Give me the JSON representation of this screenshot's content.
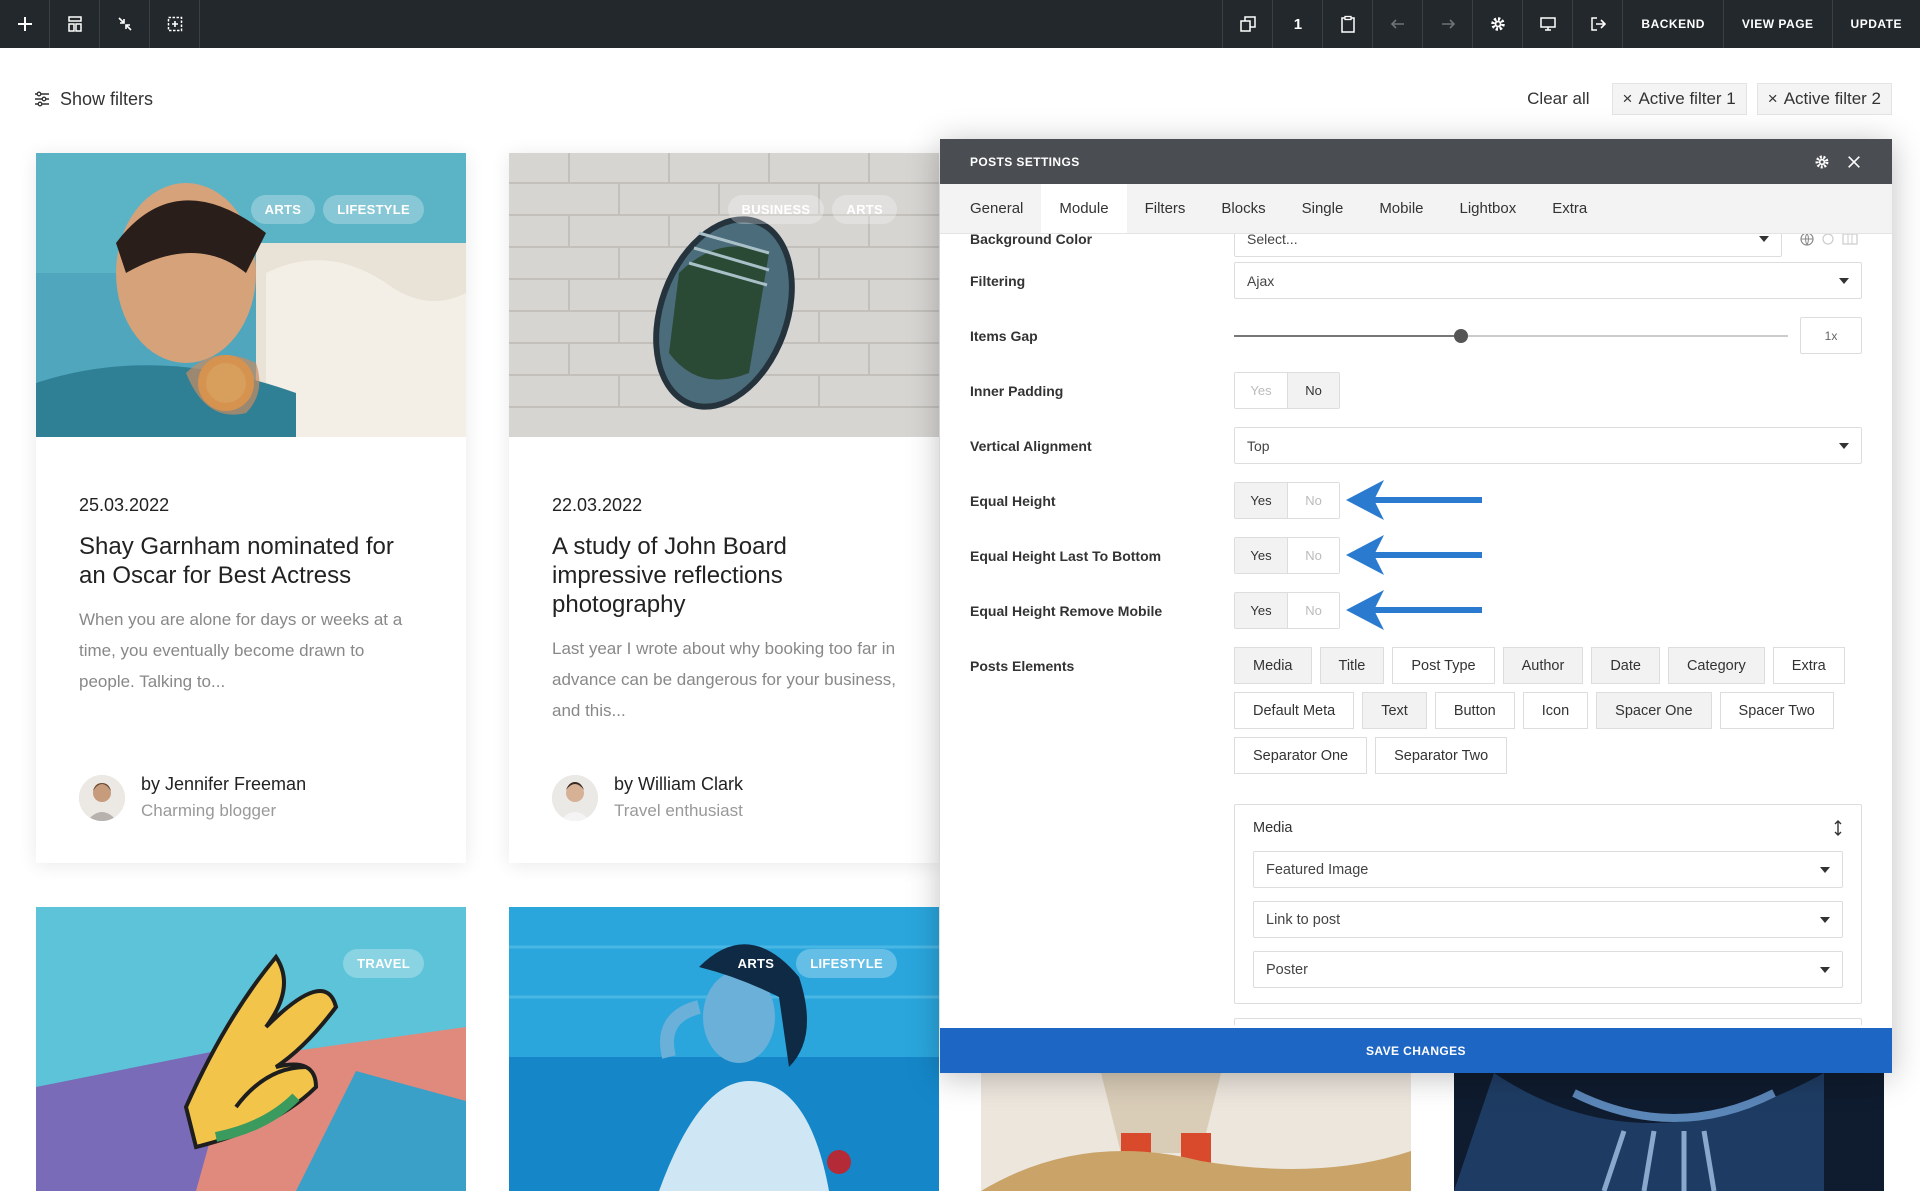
{
  "toolbar": {
    "left_icons": [
      "plus-icon",
      "layout-icon",
      "collapse-icon",
      "select-area-icon"
    ],
    "right_icons": [
      "duplicate-icon",
      "clipboard-icon",
      "undo-icon",
      "redo-icon",
      "gear-icon",
      "desktop-icon",
      "exit-icon"
    ],
    "counter": "1",
    "backend_label": "BACKEND",
    "view_page_label": "VIEW PAGE",
    "update_label": "UPDATE"
  },
  "filters": {
    "show_label": "Show filters",
    "clear_label": "Clear all",
    "active": [
      "Active filter 1",
      "Active filter 2"
    ],
    "remove_symbol": "×"
  },
  "cards": [
    {
      "tags": [
        "ARTS",
        "LIFESTYLE"
      ],
      "date": "25.03.2022",
      "title": "Shay Garnham nominated for an Oscar for Best Actress",
      "excerpt": "When you are alone for days or weeks at a time, you eventually become drawn to people. Talking to...",
      "author": "by Jennifer Freeman",
      "role": "Charming blogger"
    },
    {
      "tags": [
        "BUSINESS",
        "ARTS"
      ],
      "date": "22.03.2022",
      "title": "A study of John Board impressive reflections photography",
      "excerpt": "Last year I wrote about why booking too far in advance can be dangerous for your business, and this...",
      "author": "by William Clark",
      "role": "Travel enthusiast"
    }
  ],
  "lower_cards": [
    {
      "tags": [
        "TRAVEL"
      ]
    },
    {
      "tags": [
        "ARTS",
        "LIFESTYLE"
      ]
    }
  ],
  "panel": {
    "title": "POSTS SETTINGS",
    "tabs": [
      "General",
      "Module",
      "Filters",
      "Blocks",
      "Single",
      "Mobile",
      "Lightbox",
      "Extra"
    ],
    "active_tab": "Module",
    "background_color_label": "Background Color",
    "background_color_value": "Select...",
    "filtering_label": "Filtering",
    "filtering_value": "Ajax",
    "items_gap_label": "Items Gap",
    "items_gap_value": "1x",
    "items_gap_fraction": 0.41,
    "inner_padding_label": "Inner Padding",
    "vertical_alignment_label": "Vertical Alignment",
    "vertical_alignment_value": "Top",
    "equal_height_label": "Equal Height",
    "equal_height_last_label": "Equal Height Last To Bottom",
    "equal_height_remove_label": "Equal Height Remove Mobile",
    "yes_label": "Yes",
    "no_label": "No",
    "inner_padding": "No",
    "equal_height": "Yes",
    "equal_height_last": "Yes",
    "equal_height_remove": "Yes",
    "posts_elements_label": "Posts Elements",
    "posts_elements": [
      {
        "label": "Media",
        "on": true
      },
      {
        "label": "Title",
        "on": true
      },
      {
        "label": "Post Type",
        "on": false
      },
      {
        "label": "Author",
        "on": true
      },
      {
        "label": "Date",
        "on": true
      },
      {
        "label": "Category",
        "on": true
      },
      {
        "label": "Extra",
        "on": false
      },
      {
        "label": "Default Meta",
        "on": false
      },
      {
        "label": "Text",
        "on": true
      },
      {
        "label": "Button",
        "on": false
      },
      {
        "label": "Icon",
        "on": false
      },
      {
        "label": "Spacer One",
        "on": true
      },
      {
        "label": "Spacer Two",
        "on": false
      },
      {
        "label": "Separator One",
        "on": false
      },
      {
        "label": "Separator Two",
        "on": false
      }
    ],
    "media": {
      "label": "Media",
      "selects": [
        "Featured Image",
        "Link to post",
        "Poster"
      ]
    },
    "save_label": "SAVE CHANGES",
    "arrow_color": "#2a7bd0"
  }
}
